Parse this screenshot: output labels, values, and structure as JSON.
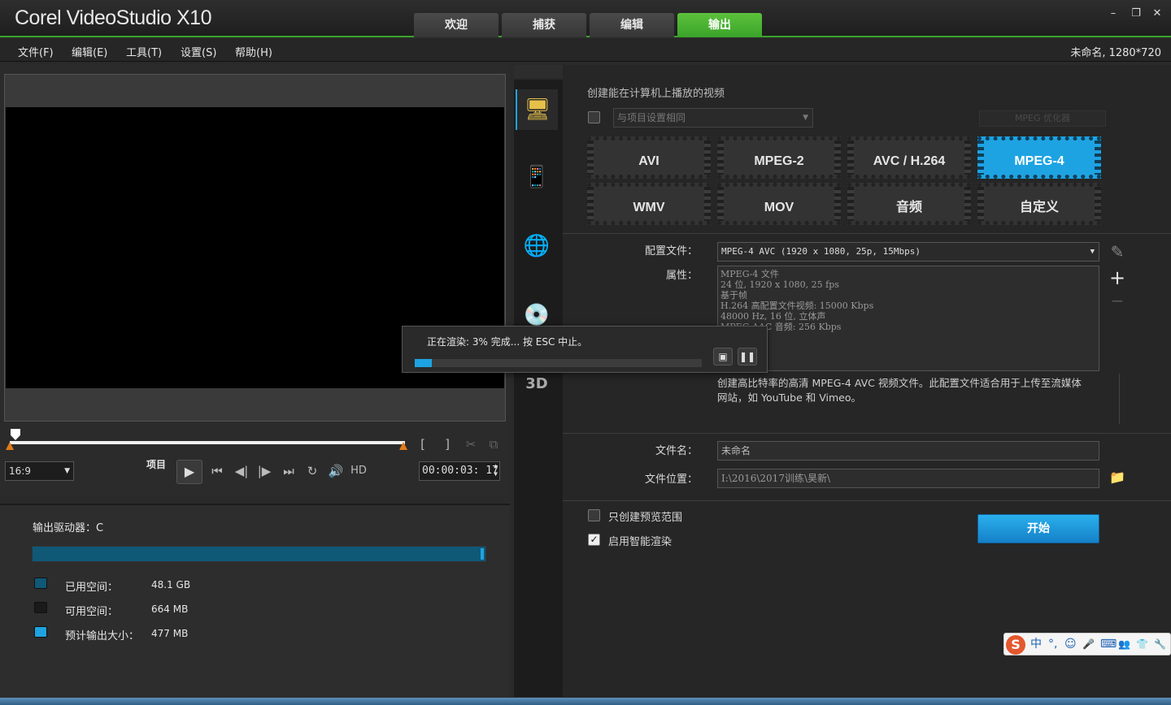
{
  "app": {
    "title": "Corel VideoStudio X10"
  },
  "step_tabs": [
    {
      "label": "欢迎",
      "active": false
    },
    {
      "label": "捕获",
      "active": false
    },
    {
      "label": "编辑",
      "active": false
    },
    {
      "label": "输出",
      "active": true
    }
  ],
  "window_controls": {
    "minimize": "–",
    "maximize": "❐",
    "close": "✕"
  },
  "menu": [
    "文件(F)",
    "编辑(E)",
    "工具(T)",
    "设置(S)",
    "帮助(H)"
  ],
  "project_info": "未命名, 1280*720",
  "player": {
    "aspect": "16:9",
    "mode_label": "项目",
    "hd_label": "HD",
    "timecode": "00:00:03: 17",
    "scrub_position": 0
  },
  "drive": {
    "label": "输出驱动器：C",
    "used_fraction": 0.99,
    "legend": [
      {
        "label": "已用空间：",
        "value": "48.1 GB",
        "color": "#0f5977"
      },
      {
        "label": "可用空间：",
        "value": "664 MB",
        "color": "#1a1a1a"
      },
      {
        "label": "预计输出大小：",
        "value": "477 MB",
        "color": "#1fa3e0"
      }
    ]
  },
  "side_icons": [
    "computer-icon",
    "mobile-device-icon",
    "web-icon",
    "dvd-icon",
    "3d-icon"
  ],
  "output": {
    "heading": "创建能在计算机上播放的视频",
    "same_as_project_label": "与项目设置相同",
    "mpeg_optimizer_label": "MPEG 优化器",
    "formats": [
      {
        "label": "AVI",
        "selected": false
      },
      {
        "label": "MPEG-2",
        "selected": false
      },
      {
        "label": "AVC / H.264",
        "selected": false
      },
      {
        "label": "MPEG-4",
        "selected": true
      },
      {
        "label": "WMV",
        "selected": false
      },
      {
        "label": "MOV",
        "selected": false
      },
      {
        "label": "音频",
        "selected": false
      },
      {
        "label": "自定义",
        "selected": false
      }
    ],
    "profile_label": "配置文件：",
    "profile_value": "MPEG-4 AVC (1920 x 1080, 25p, 15Mbps)",
    "properties_label": "属性：",
    "properties": [
      "MPEG-4 文件",
      "24 位, 1920 x 1080, 25 fps",
      "基于帧",
      "H.264 高配置文件视频: 15000 Kbps",
      "48000 Hz, 16 位, 立体声",
      "MPEG AAC 音频: 256 Kbps"
    ],
    "description": "创建高比特率的高清 MPEG-4 AVC 视频文件。此配置文件适合用于上传至流媒体网站，如 YouTube 和 Vimeo。",
    "filename_label": "文件名：",
    "filename_value": "未命名",
    "location_label": "文件位置：",
    "location_value": "I:\\2016\\2017训练\\昊新\\",
    "preview_range_label": "只创建预览范围",
    "preview_range_checked": false,
    "smart_render_label": "启用智能渲染",
    "smart_render_checked": true,
    "start_label": "开始"
  },
  "render_dialog": {
    "text": "正在渲染: 3% 完成... 按 ESC 中止。",
    "progress": 0.06
  },
  "ime": {
    "items": [
      "中",
      "°,",
      "☺",
      "🎤",
      "⌨",
      "👥",
      "👕",
      "🔧"
    ]
  }
}
